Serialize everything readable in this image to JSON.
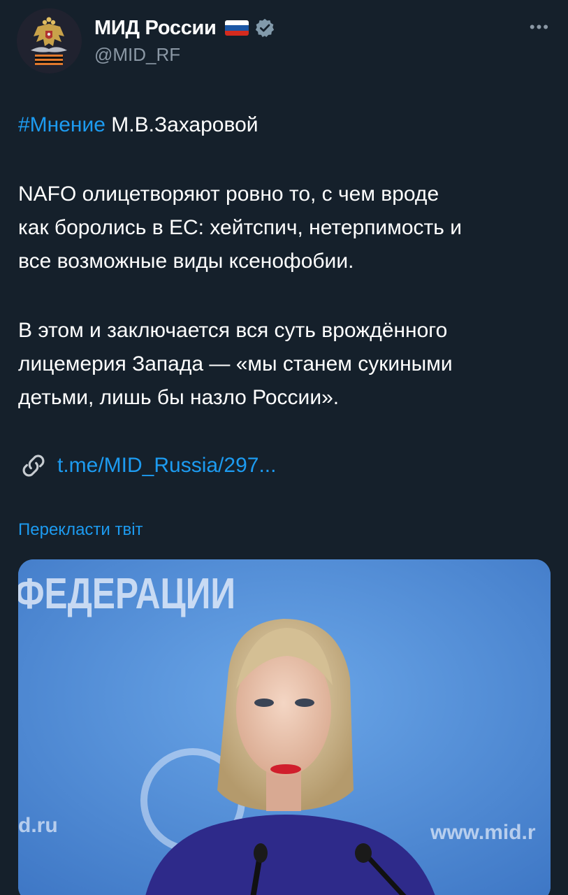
{
  "account": {
    "display_name": "МИД России",
    "handle": "@MID_RF",
    "flag_icon": "russia-flag-icon",
    "verified_icon": "verified-badge-icon"
  },
  "tweet": {
    "hashtag": "#Мнение",
    "line1_rest": " М.В.Захаровой",
    "para2_line1": "NAFO олицетворяют ровно то, с чем вроде",
    "para2_line2": "как боролись в ЕС: хейтспич, нетерпимость и",
    "para2_line3": "все возможные виды ксенофобии.",
    "para3_line1": "В этом и заключается вся суть врождённого",
    "para3_line2": "лицемерия Запада — «мы станем сукиными",
    "para3_line3": "детьми, лишь бы назло России».",
    "link_icon": "link-icon",
    "link_text": "t.me/MID_Russia/297...",
    "translate_label": "Перекласти твіт"
  },
  "media": {
    "backdrop_text_top": "ФЕДЕРАЦИИ",
    "backdrop_text_left": "d.ru",
    "backdrop_text_right": "www.mid.r"
  },
  "colors": {
    "background": "#15202b",
    "accent": "#1d9bf0",
    "secondary_text": "#8b98a5"
  }
}
